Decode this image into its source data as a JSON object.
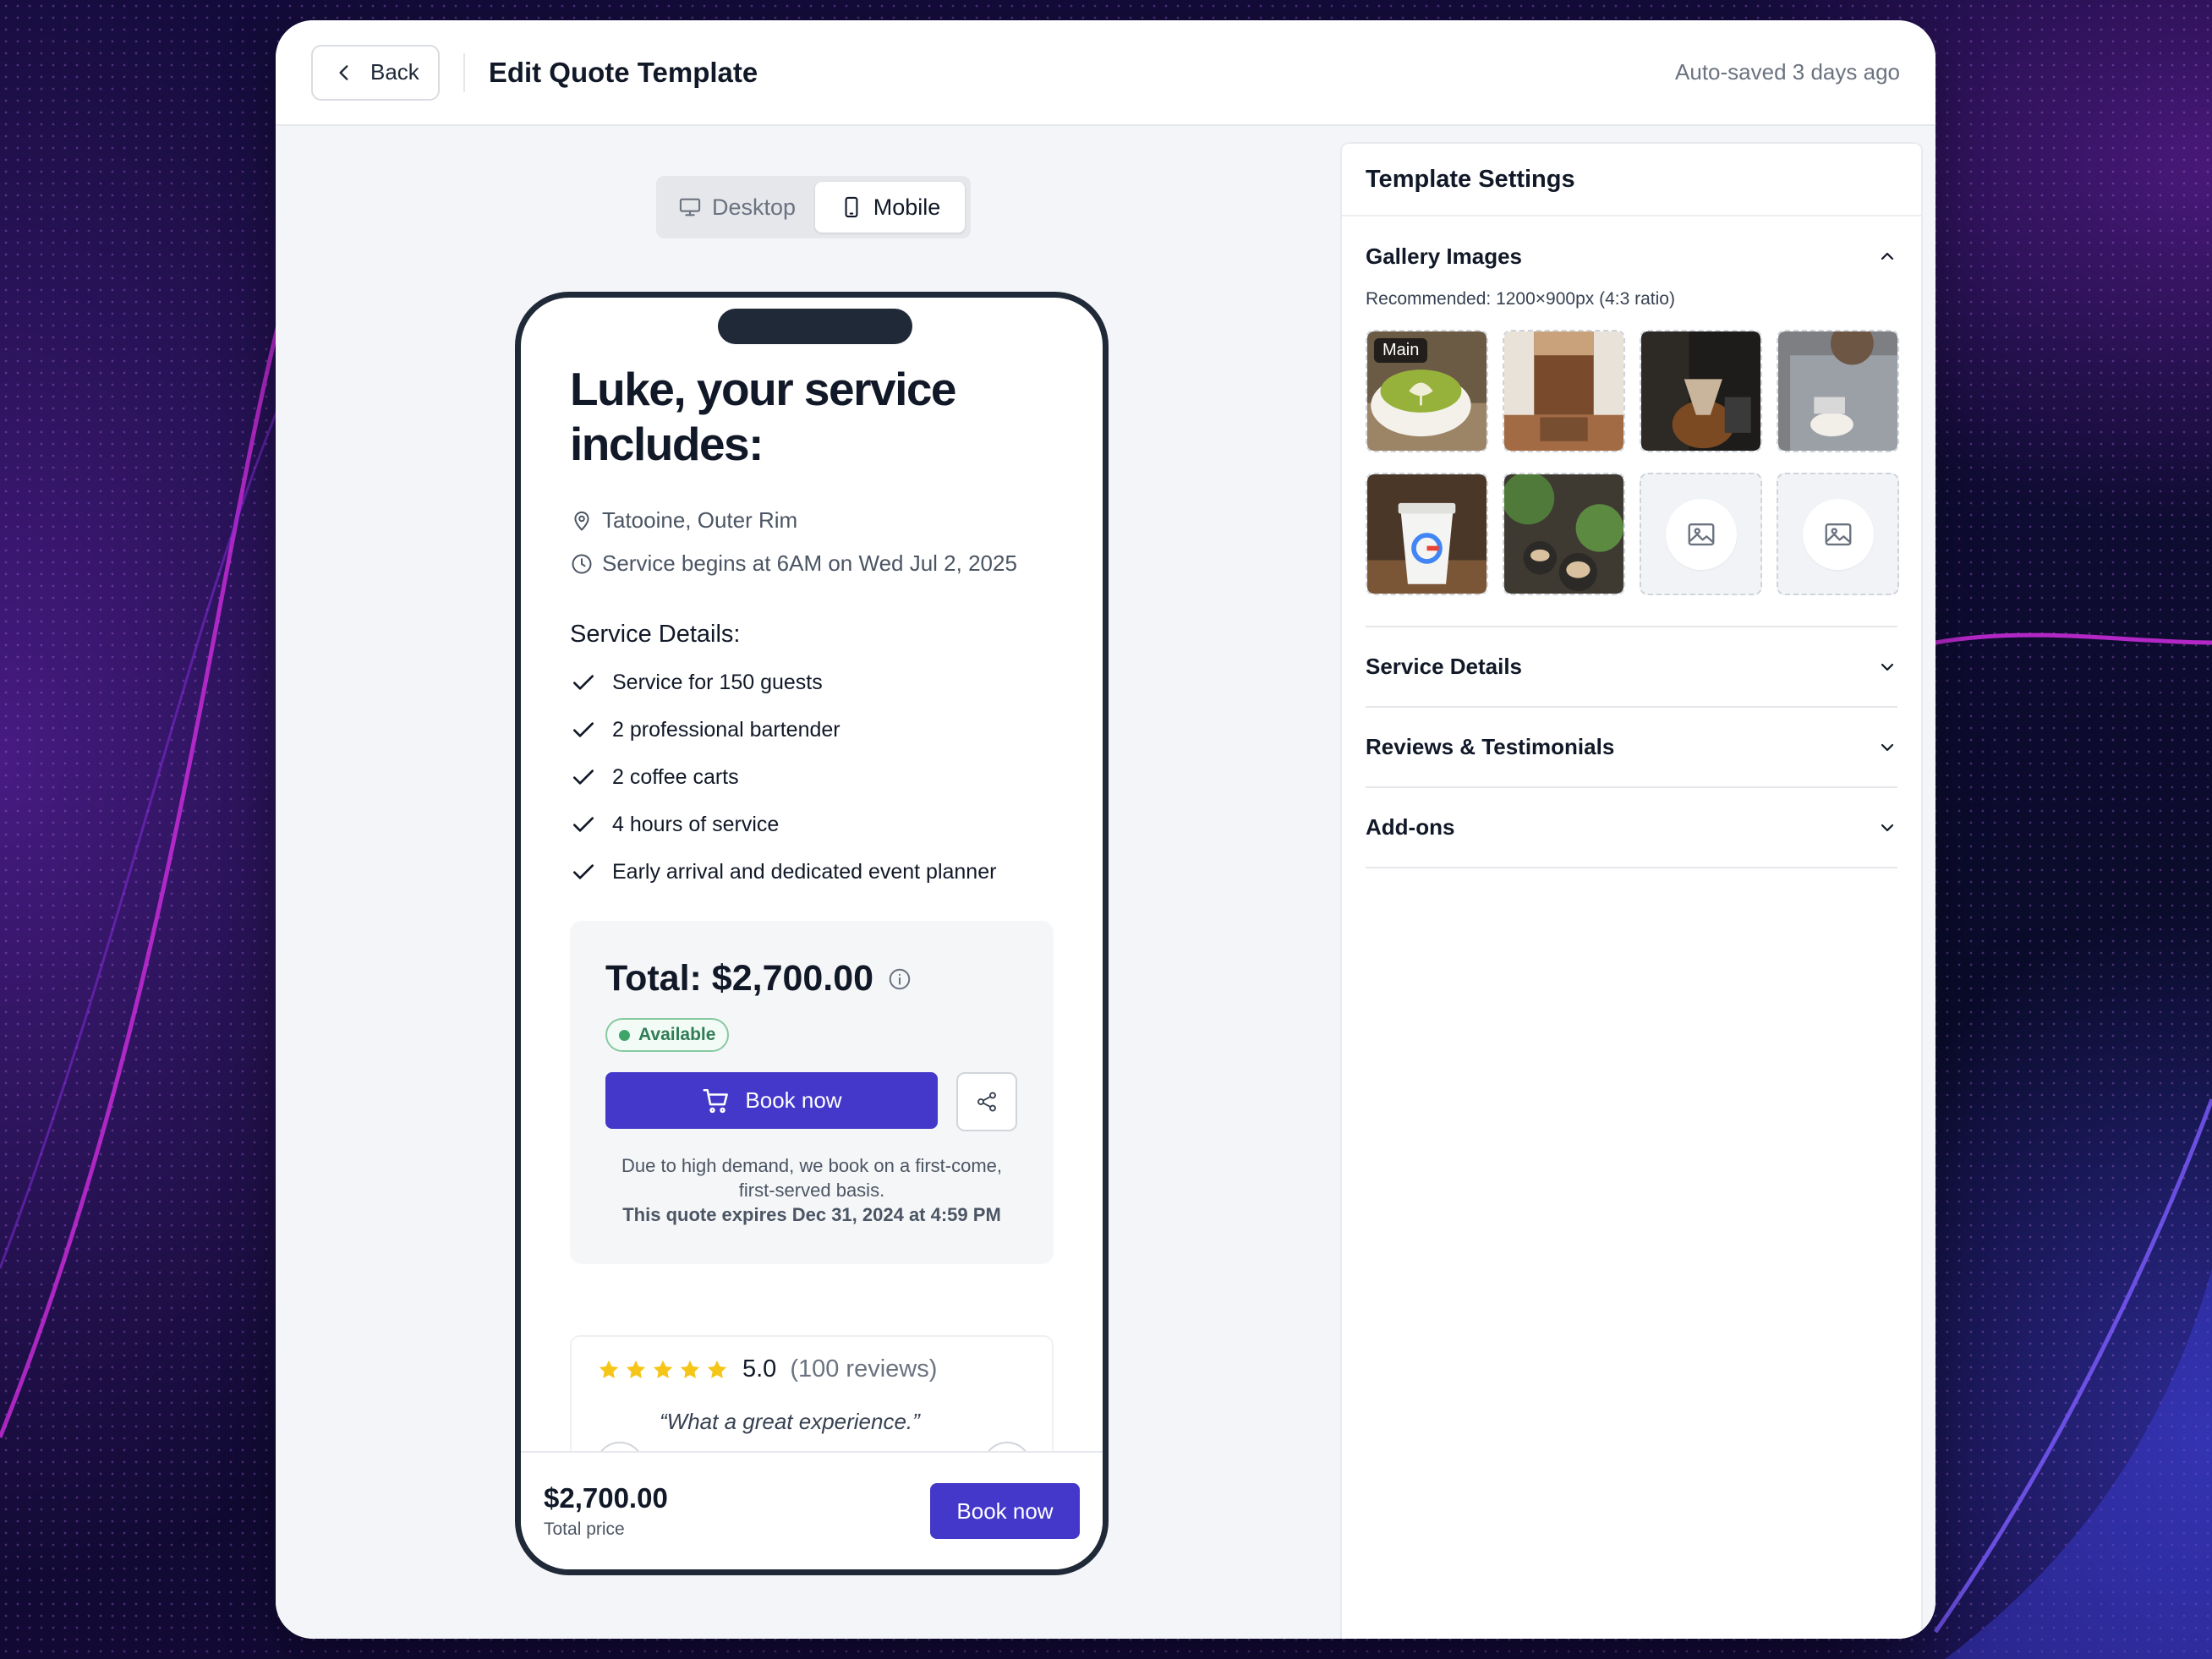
{
  "topbar": {
    "back_label": "Back",
    "title": "Edit Quote Template",
    "autosave": "Auto-saved 3 days ago"
  },
  "view_toggle": {
    "options": [
      "Desktop",
      "Mobile"
    ],
    "selected": "Mobile"
  },
  "preview": {
    "headline": "Luke, your service includes:",
    "location": "Tatooine, Outer Rim",
    "schedule": "Service begins at 6AM on Wed Jul 2, 2025",
    "details_title": "Service Details:",
    "details": [
      "Service for 150 guests",
      "2 professional bartender",
      "2 coffee carts",
      "4 hours of service",
      "Early arrival and dedicated event planner"
    ],
    "total": "Total: $2,700.00",
    "availability": "Available",
    "book_label": "Book now",
    "fine_print_1": "Due to high demand, we book on a first-come, first-served basis.",
    "fine_print_2": "This quote expires Dec 31, 2024 at 4:59 PM",
    "rating": "5.0",
    "stars": 5,
    "review_count": "(100 reviews)",
    "testimonial": "“What a great experience.”",
    "footer_price": "$2,700.00",
    "footer_sub": "Total price",
    "footer_book_label": "Book now"
  },
  "settings": {
    "title": "Template Settings",
    "gallery_title": "Gallery Images",
    "gallery_hint": "Recommended: 1200×900px (4:3 ratio)",
    "main_tag": "Main",
    "images": [
      "matcha-latte",
      "iced-coffee",
      "pour-over",
      "barista-pouring",
      "google-cup",
      "latte-plants",
      "empty",
      "empty"
    ],
    "sections": [
      "Service Details",
      "Reviews & Testimonials",
      "Add-ons"
    ]
  },
  "colors": {
    "primary": "#4338ca",
    "available": "#3ea46a",
    "star": "#f5c518"
  }
}
